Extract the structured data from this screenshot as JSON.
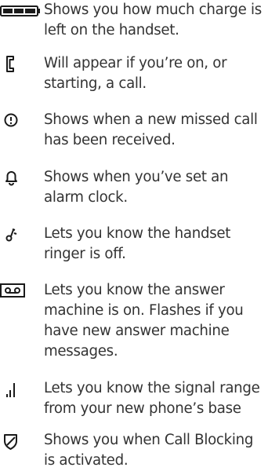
{
  "items": [
    {
      "icon": "battery-icon",
      "text": "Shows you how much charge is left on the handset."
    },
    {
      "icon": "phone-handset-icon",
      "text": "Will appear if you’re on, or starting, a call."
    },
    {
      "icon": "missed-call-alert-icon",
      "text": "Shows when a new missed call has been received."
    },
    {
      "icon": "alarm-bell-icon",
      "text": "Shows when you’ve set an alarm clock."
    },
    {
      "icon": "ringer-off-icon",
      "text": "Lets you know the handset ringer is off."
    },
    {
      "icon": "answer-machine-icon",
      "text": "Lets you know the answer machine is on. Flashes if you have new answer machine messages."
    },
    {
      "icon": "signal-strength-icon",
      "text": "Lets you know the signal range from your new phone’s base"
    },
    {
      "icon": "call-blocking-shield-icon",
      "text": "Shows you when Call Blocking is activated."
    }
  ],
  "colors": {
    "text": "#333333",
    "icon": "#1a1a1a"
  }
}
